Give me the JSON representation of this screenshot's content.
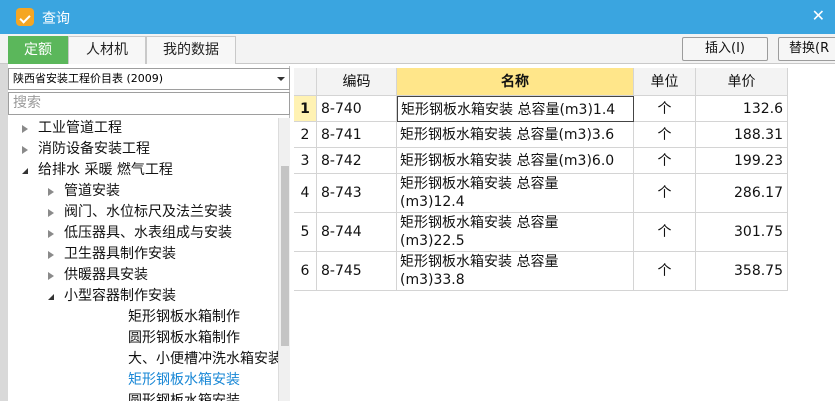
{
  "window": {
    "title": "查询",
    "accent": "#3aa5e0"
  },
  "tabs": [
    {
      "label": "定额",
      "active": true
    },
    {
      "label": "人材机",
      "active": false
    },
    {
      "label": "我的数据",
      "active": false
    }
  ],
  "toolbar": {
    "insert_label": "插入(I)",
    "replace_label": "替换(R"
  },
  "sidebar": {
    "catalog": "陕西省安装工程价目表 (2009)",
    "search_placeholder": "搜索",
    "tree": [
      {
        "label": "工业管道工程",
        "level": 0,
        "state": "closed"
      },
      {
        "label": "消防设备安装工程",
        "level": 0,
        "state": "closed"
      },
      {
        "label": "给排水 采暖 燃气工程",
        "level": 0,
        "state": "open"
      },
      {
        "label": "管道安装",
        "level": 1,
        "state": "closed"
      },
      {
        "label": "阀门、水位标尺及法兰安装",
        "level": 1,
        "state": "closed"
      },
      {
        "label": "低压器具、水表组成与安装",
        "level": 1,
        "state": "closed"
      },
      {
        "label": "卫生器具制作安装",
        "level": 1,
        "state": "closed"
      },
      {
        "label": "供暖器具安装",
        "level": 1,
        "state": "closed"
      },
      {
        "label": "小型容器制作安装",
        "level": 1,
        "state": "open"
      },
      {
        "label": "矩形钢板水箱制作",
        "level": 2,
        "state": "leaf"
      },
      {
        "label": "圆形钢板水箱制作",
        "level": 2,
        "state": "leaf"
      },
      {
        "label": "大、小便槽冲洗水箱安装",
        "level": 2,
        "state": "leaf"
      },
      {
        "label": "矩形钢板水箱安装",
        "level": 2,
        "state": "leaf",
        "selected": true
      },
      {
        "label": "圆形钢板水箱安装",
        "level": 2,
        "state": "leaf"
      }
    ]
  },
  "table": {
    "columns": [
      "编码",
      "名称",
      "单位",
      "单价"
    ],
    "rows": [
      {
        "n": "1",
        "code": "8-740",
        "name_lines": [
          "矩形钢板水箱安装 总容量(m3)1.4"
        ],
        "unit": "个",
        "price": "132.6"
      },
      {
        "n": "2",
        "code": "8-741",
        "name_lines": [
          "矩形钢板水箱安装 总容量(m3)3.6"
        ],
        "unit": "个",
        "price": "188.31"
      },
      {
        "n": "3",
        "code": "8-742",
        "name_lines": [
          "矩形钢板水箱安装 总容量(m3)6.0"
        ],
        "unit": "个",
        "price": "199.23"
      },
      {
        "n": "4",
        "code": "8-743",
        "name_lines": [
          "矩形钢板水箱安装 总容量",
          "(m3)12.4"
        ],
        "unit": "个",
        "price": "286.17"
      },
      {
        "n": "5",
        "code": "8-744",
        "name_lines": [
          "矩形钢板水箱安装 总容量",
          "(m3)22.5"
        ],
        "unit": "个",
        "price": "301.75"
      },
      {
        "n": "6",
        "code": "8-745",
        "name_lines": [
          "矩形钢板水箱安装 总容量",
          "(m3)33.8"
        ],
        "unit": "个",
        "price": "358.75"
      }
    ]
  }
}
